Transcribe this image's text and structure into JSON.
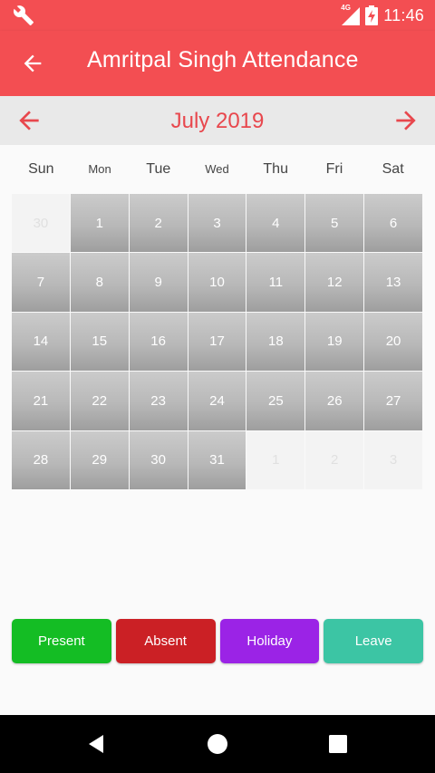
{
  "status": {
    "time": "11:46",
    "network": "4G"
  },
  "appbar": {
    "title": "Amritpal Singh Attendance"
  },
  "month": {
    "label": "July 2019"
  },
  "weekdays": [
    "Sun",
    "Mon",
    "Tue",
    "Wed",
    "Thu",
    "Fri",
    "Sat"
  ],
  "calendar": {
    "days": [
      {
        "label": "30",
        "outside": true
      },
      {
        "label": "1"
      },
      {
        "label": "2"
      },
      {
        "label": "3"
      },
      {
        "label": "4"
      },
      {
        "label": "5"
      },
      {
        "label": "6"
      },
      {
        "label": "7"
      },
      {
        "label": "8"
      },
      {
        "label": "9"
      },
      {
        "label": "10"
      },
      {
        "label": "11"
      },
      {
        "label": "12"
      },
      {
        "label": "13"
      },
      {
        "label": "14"
      },
      {
        "label": "15"
      },
      {
        "label": "16"
      },
      {
        "label": "17"
      },
      {
        "label": "18"
      },
      {
        "label": "19"
      },
      {
        "label": "20"
      },
      {
        "label": "21"
      },
      {
        "label": "22"
      },
      {
        "label": "23"
      },
      {
        "label": "24"
      },
      {
        "label": "25"
      },
      {
        "label": "26"
      },
      {
        "label": "27"
      },
      {
        "label": "28"
      },
      {
        "label": "29"
      },
      {
        "label": "30"
      },
      {
        "label": "31"
      },
      {
        "label": "1",
        "outside": true
      },
      {
        "label": "2",
        "outside": true
      },
      {
        "label": "3",
        "outside": true
      }
    ]
  },
  "legend": {
    "present": "Present",
    "absent": "Absent",
    "holiday": "Holiday",
    "leave": "Leave"
  },
  "colors": {
    "primary": "#f34e52",
    "month_label": "#e8474d",
    "present": "#14bd24",
    "absent": "#cb2025",
    "holiday": "#9b23e6",
    "leave": "#3cc5a4"
  }
}
